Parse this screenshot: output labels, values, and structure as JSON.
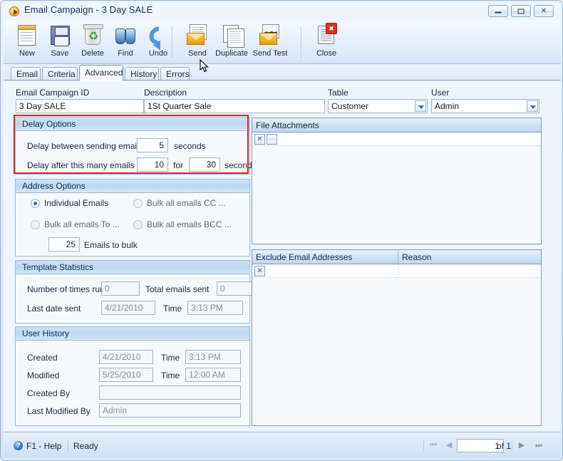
{
  "window": {
    "title": "Email Campaign - 3 Day SALE",
    "icon": "play-circle-icon",
    "controls": {
      "minimize": "–",
      "maximize": "□",
      "close": "✕"
    }
  },
  "toolbar": {
    "buttons": [
      {
        "label": "New",
        "icon": "new-document-icon"
      },
      {
        "label": "Save",
        "icon": "floppy-disk-icon"
      },
      {
        "label": "Delete",
        "icon": "recycle-bin-icon"
      },
      {
        "label": "Find",
        "icon": "binoculars-icon"
      },
      {
        "label": "Undo",
        "icon": "undo-arrow-icon"
      },
      {
        "label": "Send",
        "icon": "send-envelope-icon"
      },
      {
        "label": "Duplicate",
        "icon": "duplicate-pages-icon"
      },
      {
        "label": "Send Test",
        "icon": "send-test-envelope-icon"
      },
      {
        "label": "Close",
        "icon": "close-document-icon"
      }
    ]
  },
  "tabs": [
    {
      "label": "Email",
      "active": false
    },
    {
      "label": "Criteria",
      "active": false
    },
    {
      "label": "Advanced",
      "active": true
    },
    {
      "label": "History",
      "active": false
    },
    {
      "label": "Errors",
      "active": false
    }
  ],
  "header_fields": {
    "campaign_id_label": "Email Campaign ID",
    "campaign_id_value": "3 Day SALE",
    "description_label": "Description",
    "description_value": "1St Quarter Sale",
    "table_label": "Table",
    "table_value": "Customer",
    "user_label": "User",
    "user_value": "Admin"
  },
  "delay_options": {
    "title": "Delay Options",
    "highlight_color": "#ee1c1c",
    "row1_label": "Delay between sending email",
    "row1_value": "5",
    "row1_unit": "seconds",
    "row2_label": "Delay after this many emails",
    "row2_value": "10",
    "row2_mid": "for",
    "row2_value2": "30",
    "row2_unit": "seconds"
  },
  "address_options": {
    "title": "Address Options",
    "radios": [
      {
        "label": "Individual Emails",
        "selected": true
      },
      {
        "label": "Bulk all emails CC ...",
        "selected": false
      },
      {
        "label": "Bulk all emails To ...",
        "selected": false
      },
      {
        "label": "Bulk all emails BCC ...",
        "selected": false
      }
    ],
    "bulk_value": "25",
    "bulk_label": "Emails to bulk"
  },
  "template_statistics": {
    "title": "Template Statistics",
    "times_run_label": "Number of times run",
    "times_run_value": "0",
    "total_sent_label": "Total emails sent",
    "total_sent_value": "0",
    "last_date_label": "Last date sent",
    "last_date_value": "4/21/2010",
    "time_label": "Time",
    "time_value": "3:13 PM"
  },
  "user_history": {
    "title": "User History",
    "created_label": "Created",
    "created_value": "4/21/2010",
    "created_time_label": "Time",
    "created_time_value": "3:13 PM",
    "modified_label": "Modified",
    "modified_value": "5/25/2010",
    "modified_time_label": "Time",
    "modified_time_value": "12:00 AM",
    "created_by_label": "Created By",
    "created_by_value": "",
    "last_modified_by_label": "Last Modified By",
    "last_modified_by_value": "Admin"
  },
  "file_attachments": {
    "title": "File Attachments",
    "row_delete_icon": "✕",
    "row_browse_icon": "⋯"
  },
  "exclude_grid": {
    "col1": "Exclude Email Addresses",
    "col2": "Reason",
    "row_delete_icon": "✕"
  },
  "statusbar": {
    "help_icon": "?",
    "help_label": "F1 - Help",
    "status": "Ready",
    "nav_first": "⏮",
    "nav_prev": "◀",
    "page_value": "1",
    "page_of": "of 1",
    "nav_next": "▶",
    "nav_last": "⏭"
  }
}
